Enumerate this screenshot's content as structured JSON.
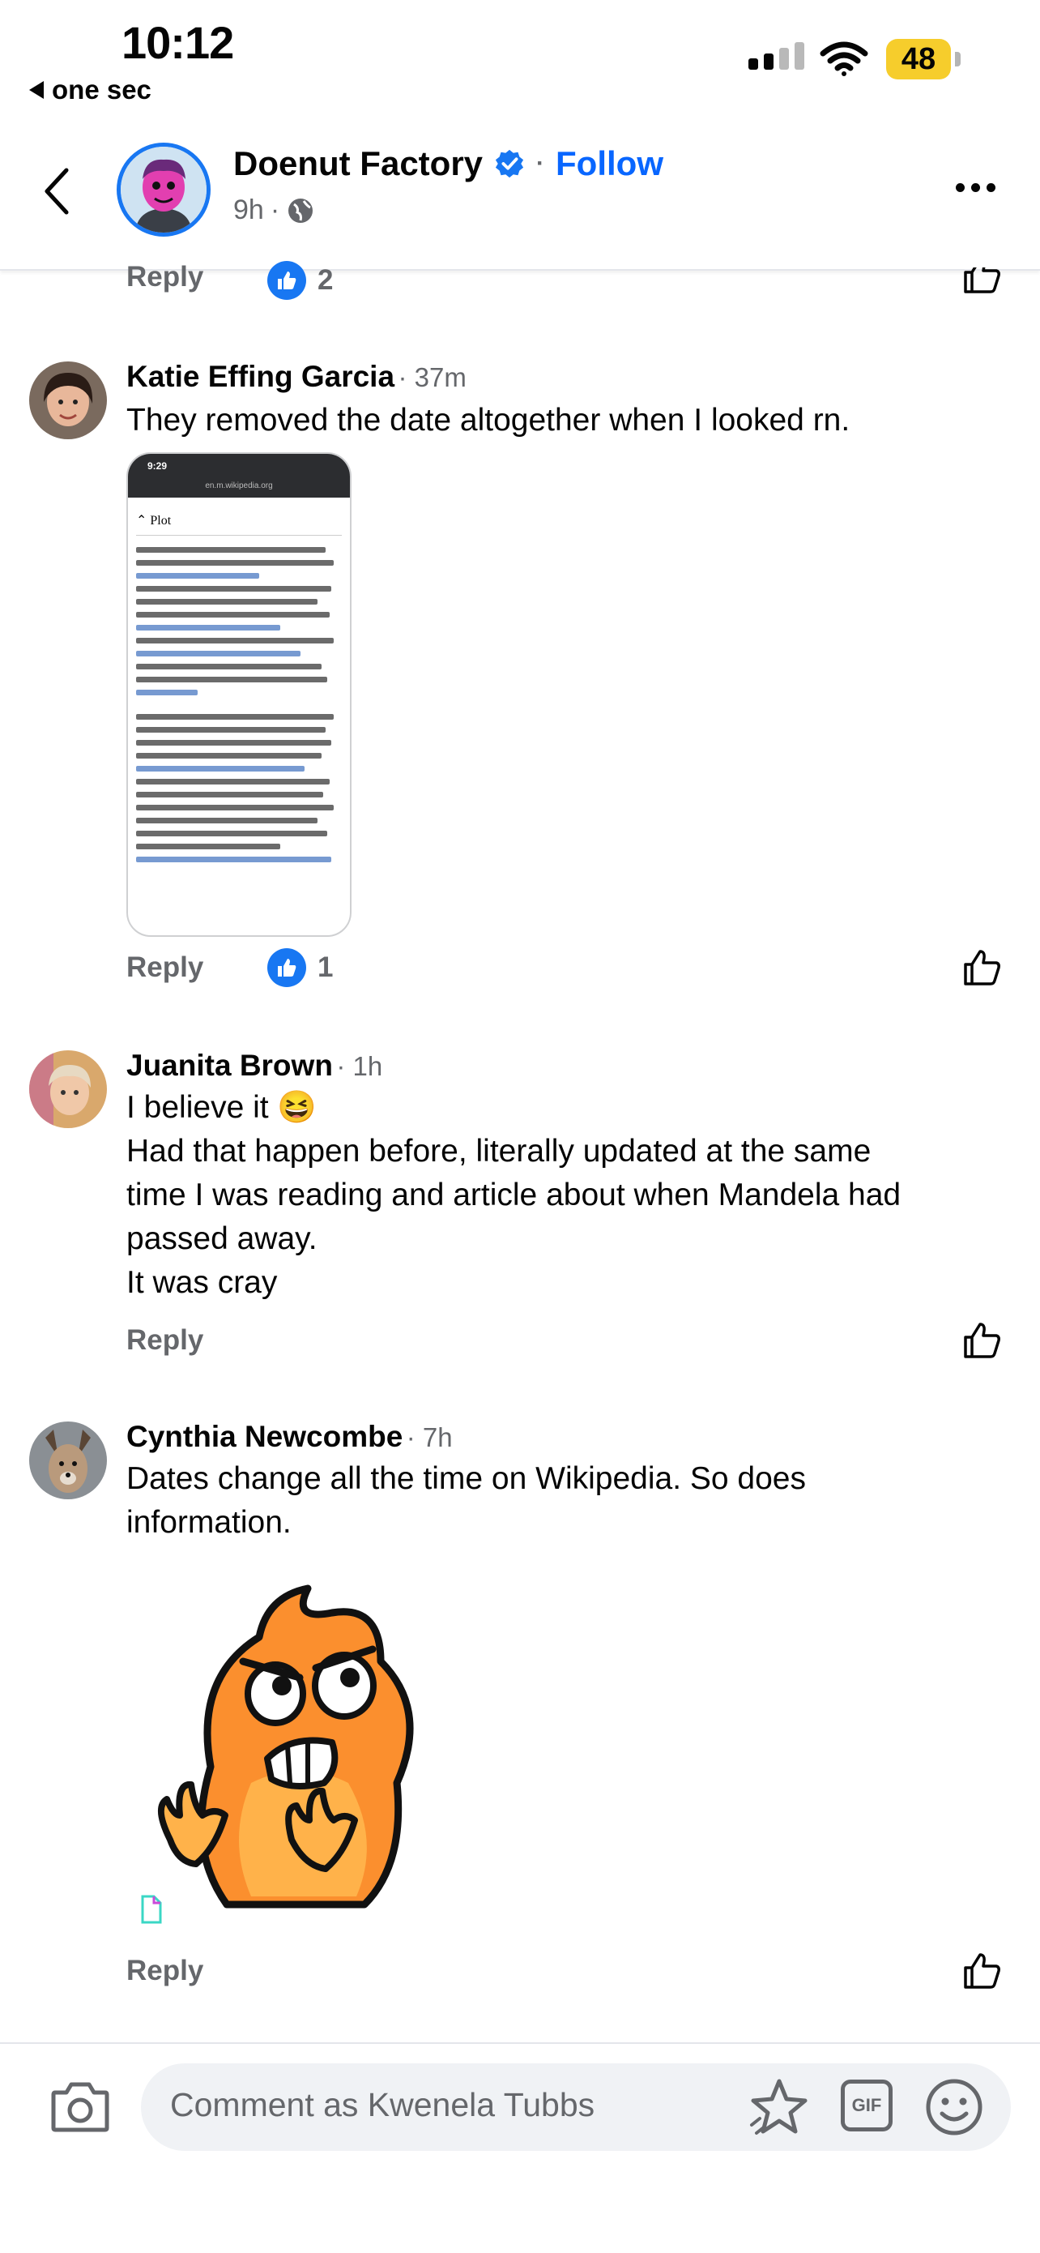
{
  "status_bar": {
    "time": "10:12",
    "back_app": "one sec",
    "battery": "48"
  },
  "header": {
    "page_name": "Doenut Factory",
    "follow": "Follow",
    "time": "9h",
    "separator": "·"
  },
  "prev_comment": {
    "reply": "Reply",
    "likes": "2"
  },
  "comments": [
    {
      "name": "Katie Effing Garcia",
      "time": "· 37m",
      "text": "They removed the date altogether when I looked rn.",
      "reply": "Reply",
      "likes": "1",
      "screenshot": {
        "time": "9:29",
        "url": "en.m.wikipedia.org",
        "section": "Plot"
      }
    },
    {
      "name": "Juanita Brown",
      "time": "· 1h",
      "lines": [
        "I believe it 😆",
        "Had that happen before, literally updated at the same",
        "time I was reading and article about when Mandela had",
        "passed away.",
        "It was cray"
      ],
      "reply": "Reply"
    },
    {
      "name": "Cynthia Newcombe",
      "time": "· 7h",
      "lines": [
        "Dates change all the time on Wikipedia. So does",
        "information."
      ],
      "reply": "Reply"
    }
  ],
  "composer": {
    "placeholder": "Comment as Kwenela Tubbs",
    "gif": "GIF"
  },
  "colors": {
    "accent": "#0866ff",
    "like_blue": "#1877f2",
    "battery": "#f6cd2c",
    "muted": "#65676b"
  },
  "icons": [
    "back-chevron-icon",
    "verified-badge-icon",
    "globe-icon",
    "more-icon",
    "like-thumb-icon",
    "camera-icon",
    "avatar-sticker-icon",
    "gif-icon",
    "emoji-icon"
  ]
}
